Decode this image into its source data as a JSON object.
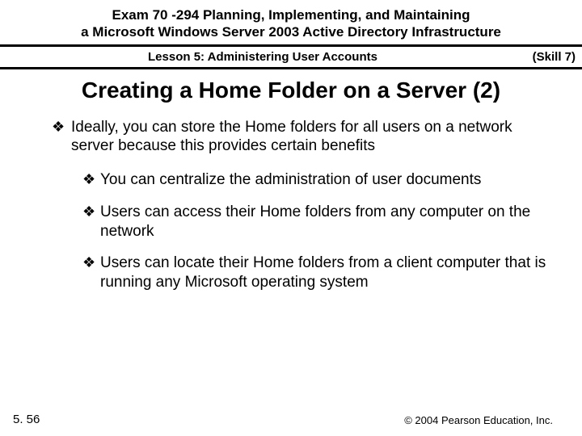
{
  "header": {
    "exam_line1": "Exam 70 -294 Planning, Implementing, and Maintaining",
    "exam_line2": "a Microsoft Windows Server 2003 Active Directory Infrastructure",
    "lesson": "Lesson 5: Administering User Accounts",
    "skill": "(Skill 7)"
  },
  "title": "Creating a Home Folder on a Server (2)",
  "bullets": {
    "main": "Ideally, you can store the Home folders for all users on a network server because this provides certain benefits",
    "sub1": "You can centralize the administration of user documents",
    "sub2": "Users can access their Home folders from any computer on the network",
    "sub3": "Users can locate their Home folders from a client computer that is running any Microsoft operating system"
  },
  "footer": {
    "page": "5. 56",
    "copyright": "© 2004 Pearson Education, Inc."
  },
  "marker": "❖"
}
